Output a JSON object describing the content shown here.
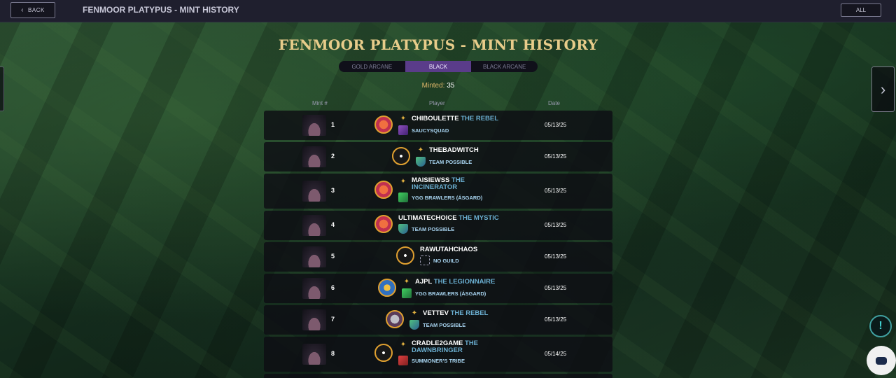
{
  "topbar": {
    "back_label": "BACK",
    "title": "FENMOOR PLATYPUS - MINT HISTORY",
    "all_label": "ALL"
  },
  "main_title": "FENMOOR PLATYPUS - MINT HISTORY",
  "tabs": [
    {
      "label": "GOLD ARCANE",
      "active": false
    },
    {
      "label": "BLACK",
      "active": true
    },
    {
      "label": "BLACK ARCANE",
      "active": false
    }
  ],
  "minted": {
    "label": "Minted:",
    "value": "35"
  },
  "columns": {
    "mint": "Mint #",
    "player": "Player",
    "date": "Date"
  },
  "rows": [
    {
      "mint": "1",
      "name": "CHIBOULETTE",
      "title": "THE REBEL",
      "guild": "SAUCYSQUAD",
      "date": "05/13/25"
    },
    {
      "mint": "2",
      "name": "THEBADWITCH",
      "title": "",
      "guild": "TEAM POSSIBLE",
      "date": "05/13/25"
    },
    {
      "mint": "3",
      "name": "MAISIEWSS",
      "title": "THE",
      "title2": "INCINERATOR",
      "guild": "YGG BRAWLERS (ÁSGARD)",
      "date": "05/13/25"
    },
    {
      "mint": "4",
      "name": "ULTIMATECHOICE",
      "title": "THE MYSTIC",
      "guild": "TEAM POSSIBLE",
      "date": "05/13/25"
    },
    {
      "mint": "5",
      "name": "RAWUTAHCHAOS",
      "title": "",
      "guild": "NO GUILD",
      "date": "05/13/25"
    },
    {
      "mint": "6",
      "name": "AJPL",
      "title": "THE LEGIONNAIRE",
      "guild": "YGG BRAWLERS (ÁSGARD)",
      "date": "05/13/25"
    },
    {
      "mint": "7",
      "name": "VETTEV",
      "title": "THE REBEL",
      "guild": "TEAM POSSIBLE",
      "date": "05/13/25"
    },
    {
      "mint": "8",
      "name": "CRADLE2GAME",
      "title": "THE",
      "title2": "DAWNBRINGER",
      "guild": "SUMMONER'S TRIBE",
      "date": "05/14/25"
    }
  ],
  "colors": {
    "accent_gold": "#e8cc8a",
    "active_tab": "#5a3c8a",
    "title_blue": "#6aaed0"
  },
  "icons": {
    "back": "chevron-left-icon",
    "next": "chevron-right-icon",
    "alert": "exclamation-icon",
    "chat": "chat-icon"
  }
}
